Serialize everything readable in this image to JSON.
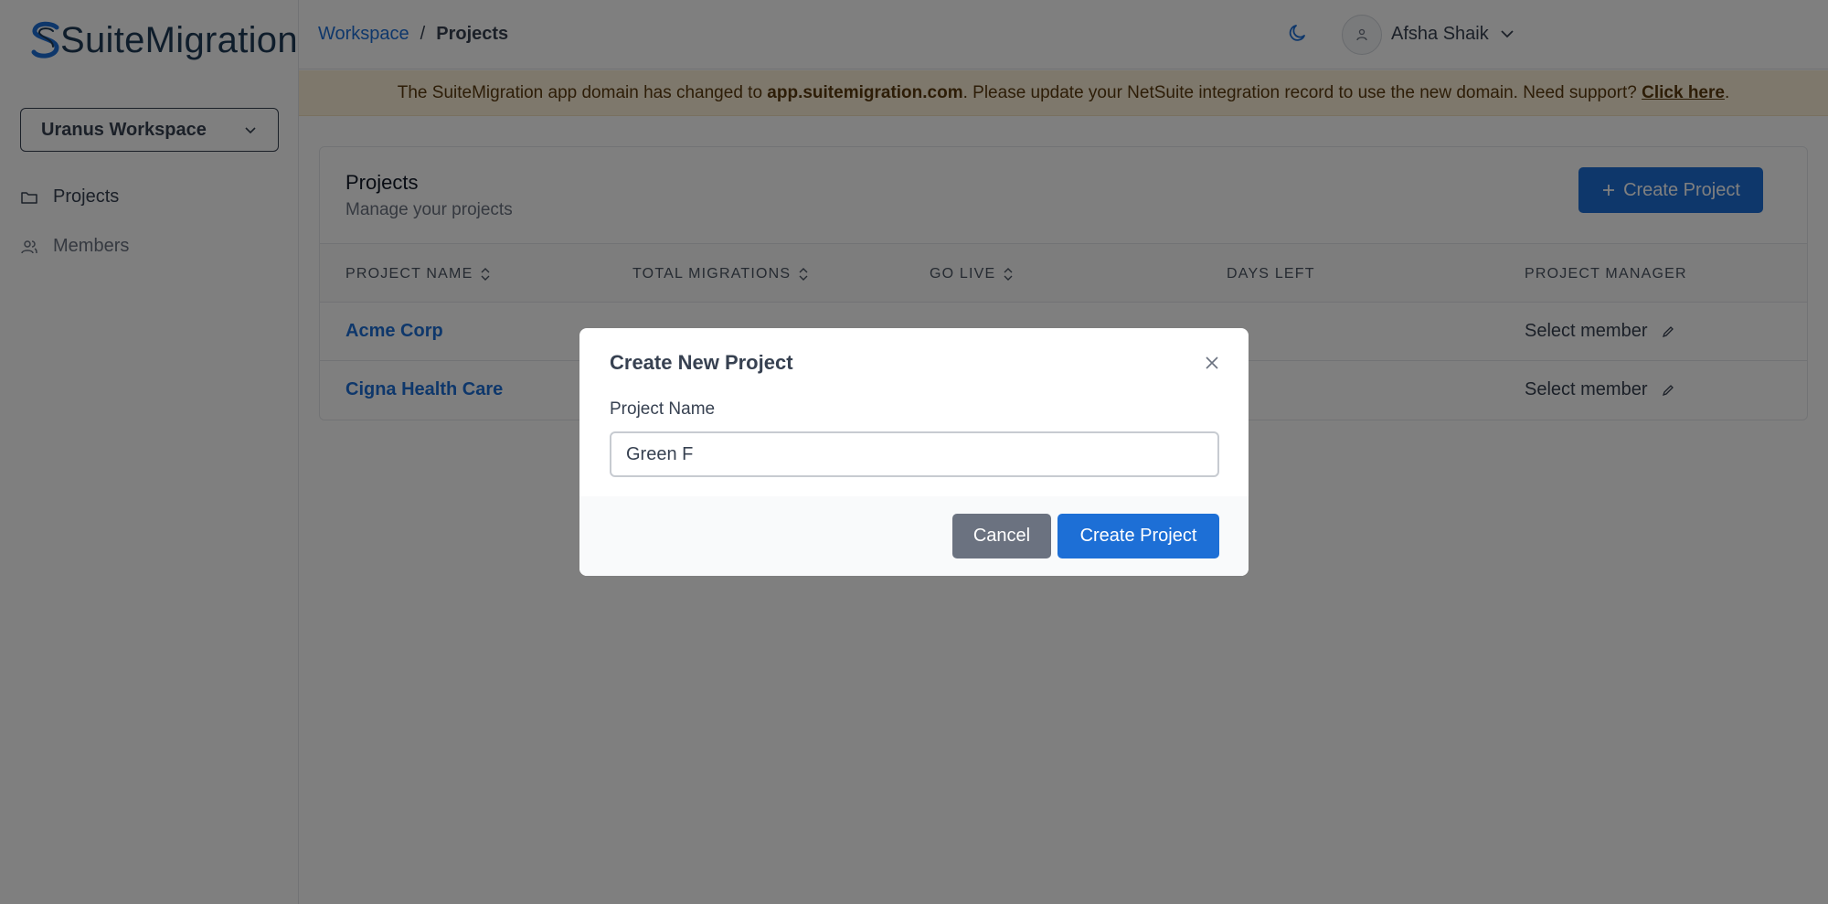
{
  "app": {
    "name": "SuiteMigration",
    "brand_color": "#1d6fd6"
  },
  "sidebar": {
    "workspace_selected": "Uranus Workspace",
    "items": [
      {
        "label": "Projects",
        "icon": "folder-icon"
      },
      {
        "label": "Members",
        "icon": "users-icon"
      }
    ]
  },
  "header": {
    "breadcrumb": {
      "parent": "Workspace",
      "separator": "/",
      "current": "Projects"
    },
    "user_name": "Afsha Shaik"
  },
  "banner": {
    "text_before": "The SuiteMigration app domain has changed to ",
    "domain": "app.suitemigration.com",
    "text_after": ". Please update your NetSuite integration record to use the new domain. Need support? ",
    "link_text": "Click here",
    "end": "."
  },
  "projects": {
    "title": "Projects",
    "subtitle": "Manage your projects",
    "create_button": "Create Project",
    "columns": [
      "PROJECT NAME",
      "TOTAL MIGRATIONS",
      "GO LIVE",
      "DAYS LEFT",
      "PROJECT MANAGER"
    ],
    "rows": [
      {
        "name": "Acme Corp",
        "manager": "Select member"
      },
      {
        "name": "Cigna Health Care",
        "manager": "Select member"
      }
    ]
  },
  "modal": {
    "title": "Create New Project",
    "field_label": "Project Name",
    "field_value": "Green F",
    "cancel_label": "Cancel",
    "submit_label": "Create Project"
  }
}
